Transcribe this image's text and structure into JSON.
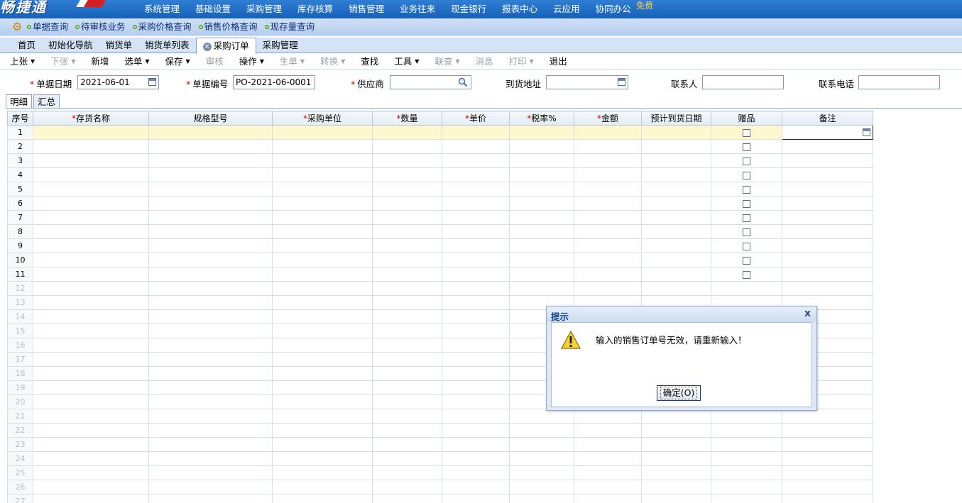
{
  "app": {
    "logo_text": "畅捷通"
  },
  "top_menu": [
    "系统管理",
    "基础设置",
    "采购管理",
    "库存核算",
    "销售管理",
    "业务往来",
    "现金银行",
    "报表中心",
    "云应用",
    "协同办公"
  ],
  "top_menu_badge": "免费",
  "quick_links": [
    "单据查询",
    "待审核业务",
    "采购价格查询",
    "销售价格查询",
    "现存量查询"
  ],
  "tabs": [
    {
      "label": "首页"
    },
    {
      "label": "初始化导航"
    },
    {
      "label": "销货单"
    },
    {
      "label": "销货单列表"
    },
    {
      "label": "采购订单",
      "active": true
    },
    {
      "label": "采购管理"
    }
  ],
  "toolbar": [
    {
      "label": "上张",
      "caret": true,
      "disabled": false
    },
    {
      "label": "下张",
      "caret": true,
      "disabled": true
    },
    {
      "label": "新增",
      "caret": false,
      "disabled": false
    },
    {
      "label": "选单",
      "caret": true,
      "disabled": false
    },
    {
      "label": "保存",
      "caret": true,
      "disabled": false
    },
    {
      "label": "审核",
      "caret": false,
      "disabled": true
    },
    {
      "label": "操作",
      "caret": true,
      "disabled": false
    },
    {
      "label": "生单",
      "caret": true,
      "disabled": true
    },
    {
      "label": "转换",
      "caret": true,
      "disabled": true
    },
    {
      "label": "查找",
      "caret": false,
      "disabled": false
    },
    {
      "label": "工具",
      "caret": true,
      "disabled": false
    },
    {
      "label": "联查",
      "caret": true,
      "disabled": true
    },
    {
      "label": "消息",
      "caret": false,
      "disabled": true
    },
    {
      "label": "打印",
      "caret": true,
      "disabled": true
    },
    {
      "label": "退出",
      "caret": false,
      "disabled": false
    }
  ],
  "form": {
    "required_mark": "*",
    "doc_date_label": "单据日期",
    "doc_date_value": "2021-06-01",
    "doc_no_label": "单据编号",
    "doc_no_value": "PO-2021-06-0001",
    "supplier_label": "供应商",
    "supplier_value": "",
    "address_label": "到货地址",
    "address_value": "",
    "contact_label": "联系人",
    "contact_value": "",
    "phone_label": "联系电话",
    "phone_value": ""
  },
  "detail_tabs": [
    "明细",
    "汇总"
  ],
  "grid": {
    "columns": [
      {
        "label": "序号",
        "required": false
      },
      {
        "label": "存货名称",
        "required": true
      },
      {
        "label": "规格型号",
        "required": false
      },
      {
        "label": "采购单位",
        "required": true
      },
      {
        "label": "数量",
        "required": true
      },
      {
        "label": "单价",
        "required": true
      },
      {
        "label": "税率%",
        "required": true
      },
      {
        "label": "金额",
        "required": true
      },
      {
        "label": "预计到货日期",
        "required": false
      },
      {
        "label": "赠品",
        "required": false
      },
      {
        "label": "备注",
        "required": false
      }
    ],
    "row_numbers": [
      "1",
      "2",
      "3",
      "4",
      "5",
      "6",
      "7",
      "8",
      "9",
      "10",
      "11",
      "12",
      "13",
      "14",
      "15",
      "16",
      "17",
      "18",
      "19",
      "20",
      "21",
      "22",
      "23",
      "24",
      "25",
      "26",
      "27"
    ],
    "active_rows": 11,
    "selected_row": 1
  },
  "dialog": {
    "title": "提示",
    "close": "x",
    "message": "输入的销售订单号无效，请重新输入！",
    "ok_label": "确定(O)"
  }
}
